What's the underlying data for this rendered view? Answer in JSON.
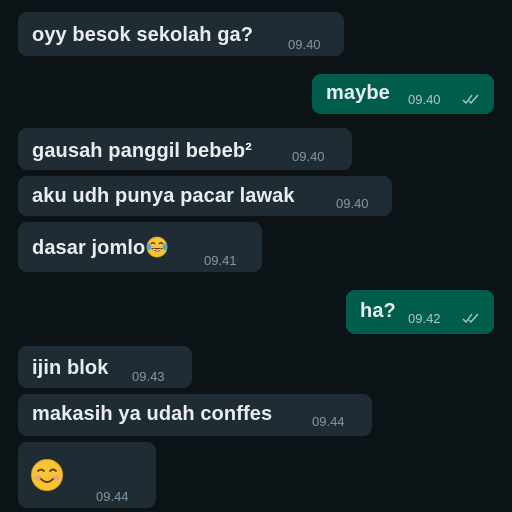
{
  "colors": {
    "background": "#0b1317",
    "incoming_bubble": "#1f2c34",
    "outgoing_bubble": "#005c4b",
    "text": "#e9edef",
    "timestamp": "#8696a0",
    "read_ticks": "#a9c9c2"
  },
  "messages": [
    {
      "direction": "incoming",
      "text": "oyy besok sekolah ga?",
      "time": "09.40"
    },
    {
      "direction": "outgoing",
      "text": "maybe",
      "time": "09.40",
      "status": "read"
    },
    {
      "direction": "incoming",
      "text": "gausah panggil bebeb²",
      "time": "09.40"
    },
    {
      "direction": "incoming",
      "text": "aku udh punya pacar lawak",
      "time": "09.40"
    },
    {
      "direction": "incoming",
      "text": "dasar jomlo",
      "emoji": "tears-of-joy-emoji",
      "time": "09.41"
    },
    {
      "direction": "outgoing",
      "text": "ha?",
      "time": "09.42",
      "status": "read"
    },
    {
      "direction": "incoming",
      "text": "ijin blok",
      "time": "09.43"
    },
    {
      "direction": "incoming",
      "text": "makasih ya udah conffes",
      "time": "09.44"
    },
    {
      "direction": "incoming",
      "text": "",
      "emoji": "smiling-face-emoji",
      "time": "09.44"
    }
  ]
}
